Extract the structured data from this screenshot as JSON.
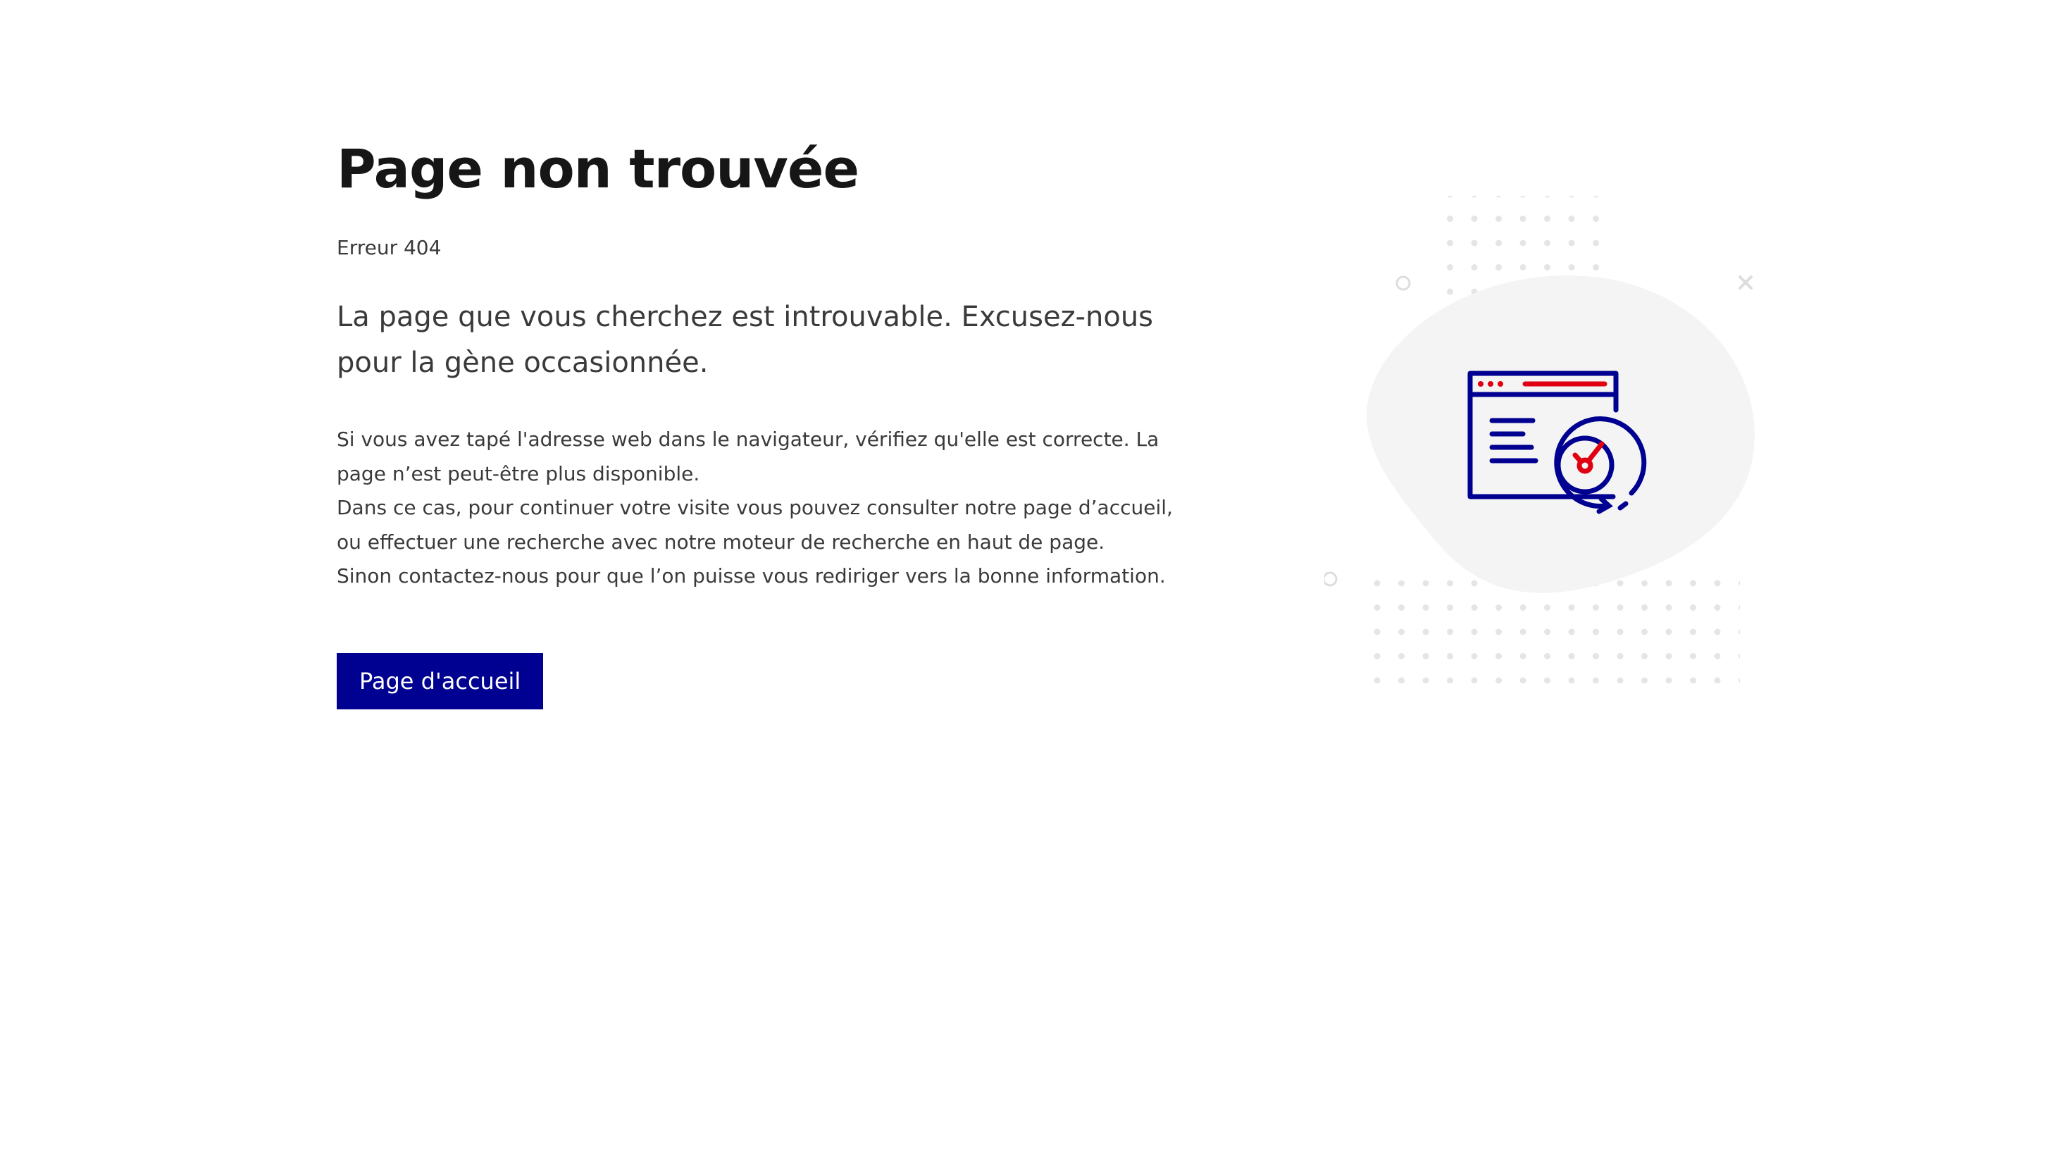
{
  "page": {
    "title": "Page non trouvée",
    "error_code": "Erreur 404",
    "lead": "La page que vous cherchez est introuvable. Excusez-nous pour la gène occasionnée.",
    "body_lines": [
      "Si vous avez tapé l'adresse web dans le navigateur, vérifiez qu'elle est correcte. La page n’est peut-être plus disponible.",
      "Dans ce cas, pour continuer votre visite vous pouvez consulter notre page d’accueil, ou effectuer une recherche avec notre moteur de recherche en haut de page.",
      "Sinon contactez-nous pour que l’on puisse vous rediriger vers la bonne information."
    ],
    "home_button_label": "Page d'accueil"
  },
  "illustration": {
    "icon": "technical-error-icon",
    "colors": {
      "primary": "#000091",
      "accent": "#e1000f",
      "blob": "#f4f4f4",
      "dots": "#e5e5e5"
    }
  },
  "colors": {
    "button_bg": "#000091",
    "button_text": "#ffffff",
    "title_text": "#161616",
    "body_text": "#3a3a3a"
  }
}
